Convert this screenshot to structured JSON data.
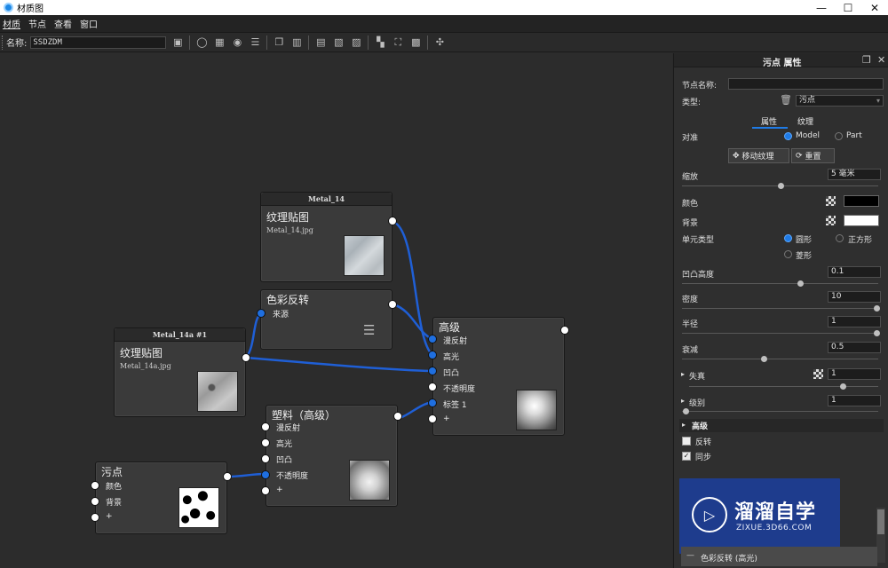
{
  "window": {
    "title": "材质图",
    "minimize": "—",
    "maximize": "☐",
    "close": "✕"
  },
  "menu": [
    "材质",
    "节点",
    "查看",
    "窗口"
  ],
  "toolbar": {
    "name_label": "名称:",
    "name_value": "SSDZDM"
  },
  "nodes": {
    "metal14": {
      "header": "Metal_14",
      "title": "纹理贴图",
      "file": "Metal_14.jpg"
    },
    "invert": {
      "title": "色彩反转",
      "inputs": [
        "来源"
      ]
    },
    "advanced": {
      "title": "高级",
      "inputs": [
        "漫反射",
        "高光",
        "凹凸",
        "不透明度",
        "标签 1",
        "+"
      ]
    },
    "metal14a": {
      "header": "Metal_14a #1",
      "title": "纹理贴图",
      "file": "Metal_14a.jpg"
    },
    "plastic": {
      "title": "塑料（高级）",
      "inputs": [
        "漫反射",
        "高光",
        "凹凸",
        "不透明度",
        "+"
      ]
    },
    "stain": {
      "title": "污点",
      "inputs": [
        "颜色",
        "背景",
        "+"
      ]
    }
  },
  "panel": {
    "header": "污点 属性",
    "node_name_label": "节点名称:",
    "node_name_value": "",
    "type_label": "类型:",
    "type_value": "污点",
    "tabs": [
      "属性",
      "纹理"
    ],
    "align_label": "对准",
    "align_options": [
      "Model",
      "Part"
    ],
    "move_texture_btn": "移动纹理",
    "reset_btn": "重置",
    "scale_label": "缩放",
    "scale_value": "5 毫米",
    "color_label": "颜色",
    "color_value": "#000000",
    "background_label": "背景",
    "background_value": "#ffffff",
    "cell_type_label": "单元类型",
    "cell_types": [
      "圆形",
      "正方形",
      "菱形"
    ],
    "bump_height_label": "凹凸高度",
    "bump_height_value": "0.1",
    "density_label": "密度",
    "density_value": "10",
    "radius_label": "半径",
    "radius_value": "1",
    "decay_label": "衰减",
    "decay_value": "0.5",
    "distortion_label": "失真",
    "distortion_value": "1",
    "level_label": "级别",
    "level_value": "1",
    "advanced_section": "高级",
    "invert_label": "反转",
    "sync_label": "同步",
    "list_item": "色彩反转 (高光)"
  },
  "watermark": {
    "name": "溜溜自学",
    "url": "ZIXUE.3D66.COM"
  },
  "colors": {
    "port_blue": "#1f6fe0",
    "edge_blue": "#1f5fd6",
    "accent": "#1f7be6"
  }
}
